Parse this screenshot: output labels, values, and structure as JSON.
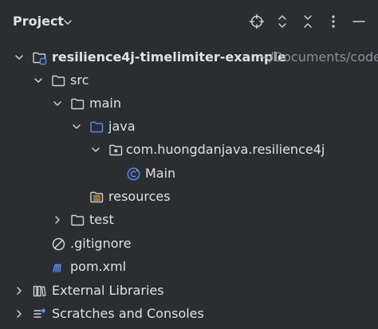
{
  "header": {
    "title": "Project",
    "icons": [
      "chevron-down-icon",
      "locate-icon",
      "expand-all-icon",
      "collapse-all-icon",
      "more-icon",
      "minimize-icon"
    ]
  },
  "tree": {
    "root": {
      "label": "resilience4j-timelimiter-example",
      "path": "~/Documents/code/"
    },
    "src": "src",
    "main": "main",
    "java": "java",
    "package": "com.huongdanjava.resilience4j",
    "main_class": "Main",
    "resources": "resources",
    "test": "test",
    "gitignore": ".gitignore",
    "pom": "pom.xml",
    "external_libraries": "External Libraries",
    "scratches": "Scratches and Consoles"
  },
  "colors": {
    "background": "#2b2d30",
    "text": "#dfe1e5",
    "muted": "#8c8f94",
    "accent_blue": "#548af7"
  }
}
